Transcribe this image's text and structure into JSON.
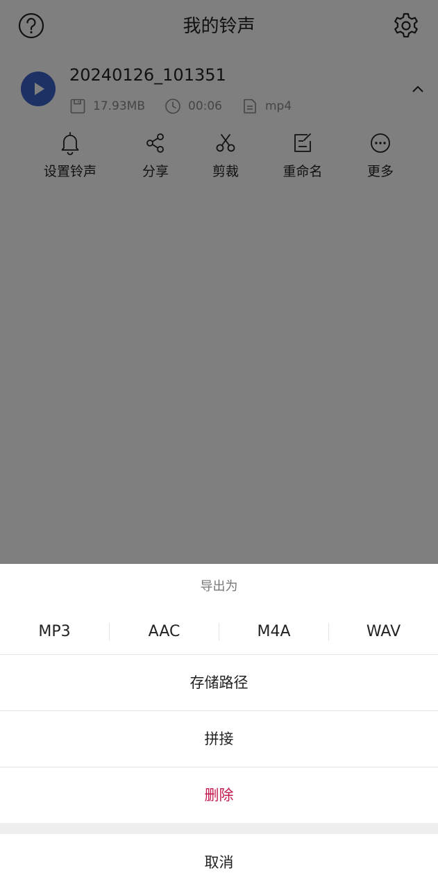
{
  "header": {
    "title": "我的铃声"
  },
  "item": {
    "file_name": "20240126_101351",
    "size": "17.93MB",
    "duration": "00:06",
    "format": "mp4"
  },
  "actions": [
    {
      "label": "设置铃声",
      "icon": "bell-icon"
    },
    {
      "label": "分享",
      "icon": "share-icon"
    },
    {
      "label": "剪裁",
      "icon": "scissors-icon"
    },
    {
      "label": "重命名",
      "icon": "edit-icon"
    },
    {
      "label": "更多",
      "icon": "more-icon"
    }
  ],
  "sheet": {
    "title": "导出为",
    "formats": [
      "MP3",
      "AAC",
      "M4A",
      "WAV"
    ],
    "storage_path": "存储路径",
    "join": "拼接",
    "delete": "删除",
    "cancel": "取消"
  },
  "colors": {
    "accent": "#3b63c9",
    "danger": "#c2184b",
    "overlay": "rgba(0,0,0,0.5)"
  }
}
